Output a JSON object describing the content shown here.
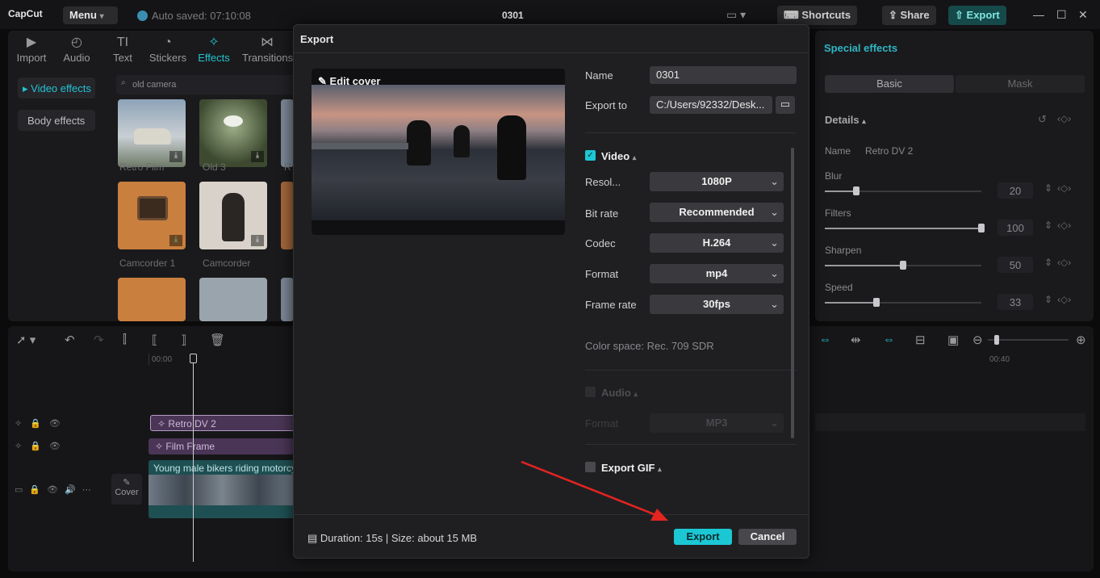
{
  "titlebar": {
    "logo": "CapCut",
    "menu_label": "Menu",
    "autosave": "Auto saved: 07:10:08",
    "project_title": "0301",
    "shortcuts_label": "Shortcuts",
    "share_label": "Share",
    "export_label": "Export"
  },
  "toolbar": {
    "items": [
      {
        "label": "Import",
        "icon": "import-icon"
      },
      {
        "label": "Audio",
        "icon": "audio-icon"
      },
      {
        "label": "Text",
        "icon": "text-icon"
      },
      {
        "label": "Stickers",
        "icon": "stickers-icon"
      },
      {
        "label": "Effects",
        "icon": "effects-icon"
      },
      {
        "label": "Transitions",
        "icon": "transitions-icon"
      }
    ],
    "active": "Effects"
  },
  "sidebar": {
    "items": [
      {
        "label": "Video effects"
      },
      {
        "label": "Body effects"
      }
    ]
  },
  "search": {
    "value": "old camera"
  },
  "effects_grid": {
    "items": [
      {
        "label": "Retro Film"
      },
      {
        "label": "Old 3"
      },
      {
        "label": "Camcorder 1"
      },
      {
        "label": "Camcorder"
      }
    ]
  },
  "right_panel": {
    "title": "Special effects",
    "tabs": [
      "Basic",
      "Mask"
    ],
    "details_label": "Details",
    "name_label": "Name",
    "name_value": "Retro DV 2",
    "params": [
      {
        "label": "Blur",
        "value": "20",
        "level": 0.2
      },
      {
        "label": "Filters",
        "value": "100",
        "level": 1.0
      },
      {
        "label": "Sharpen",
        "value": "50",
        "level": 0.5
      },
      {
        "label": "Speed",
        "value": "33",
        "level": 0.33
      }
    ]
  },
  "timeline": {
    "time_start": "00:00",
    "time_end": "00:40",
    "clips": {
      "effect1": "Retro DV 2",
      "effect2": "Film Frame",
      "video": "Young male bikers riding motorcy"
    },
    "cover_label": "Cover"
  },
  "export_dialog": {
    "title": "Export",
    "edit_cover_label": "Edit cover",
    "name_label": "Name",
    "name_value": "0301",
    "export_to_label": "Export to",
    "export_to_value": "C:/Users/92332/Desk...",
    "video_section": "Video",
    "video_checked": true,
    "resolution_label": "Resol...",
    "resolution_value": "1080P",
    "bitrate_label": "Bit rate",
    "bitrate_value": "Recommended",
    "codec_label": "Codec",
    "codec_value": "H.264",
    "format_label": "Format",
    "format_value": "mp4",
    "framerate_label": "Frame rate",
    "framerate_value": "30fps",
    "color_space": "Color space: Rec. 709 SDR",
    "audio_section": "Audio",
    "audio_checked": false,
    "audio_format_label": "Format",
    "audio_format_value": "MP3",
    "gif_section": "Export GIF",
    "gif_checked": false,
    "footer_info": "Duration: 15s | Size: about 15 MB",
    "export_button": "Export",
    "cancel_button": "Cancel"
  },
  "colors": {
    "accent": "#1cc7d4",
    "annotation_arrow": "#e3241f"
  }
}
